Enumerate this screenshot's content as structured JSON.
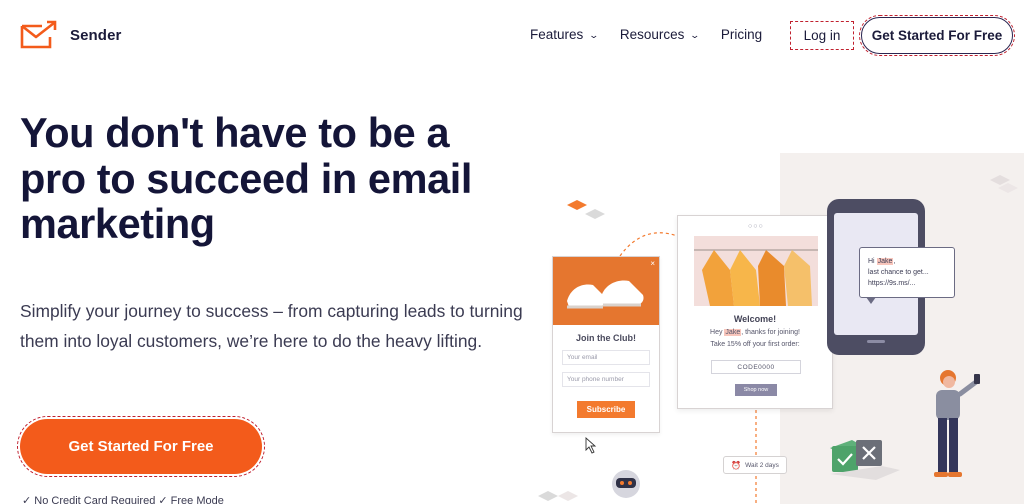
{
  "brand": {
    "name": "Sender",
    "accent": "#f35b1b"
  },
  "nav": {
    "items": [
      {
        "label": "Features",
        "icon": "chevron-down-icon"
      },
      {
        "label": "Resources",
        "icon": "chevron-down-icon"
      },
      {
        "label": "Pricing"
      }
    ],
    "login": "Log in",
    "cta": "Get Started For Free"
  },
  "hero": {
    "headline": "You don't have to be a pro to succeed in email marketing",
    "subtitle": "Simplify your journey to success – from capturing leads to turning them into loyal customers, we’re here to do the heavy lifting.",
    "cta": "Get Started For Free",
    "note": "✓ No Credit Card Required  ✓ Free Mode"
  },
  "illustration": {
    "popup": {
      "title": "Join the Club!",
      "email_placeholder": "Your email",
      "phone_placeholder": "Your phone number",
      "button": "Subscribe"
    },
    "email": {
      "welcome": "Welcome!",
      "line1_prefix": "Hey ",
      "line1_name": "Jake",
      "line1_suffix": ", thanks for joining!",
      "line2": "Take 15% off your first order:",
      "code": "CODE0000",
      "button": "Shop now"
    },
    "sms": {
      "line1_prefix": "Hi ",
      "line1_name": "Jake",
      "line1_suffix": ",",
      "line2": "last chance to get...",
      "line3": "https://9s.ms/..."
    },
    "wait": "Wait 2 days"
  }
}
